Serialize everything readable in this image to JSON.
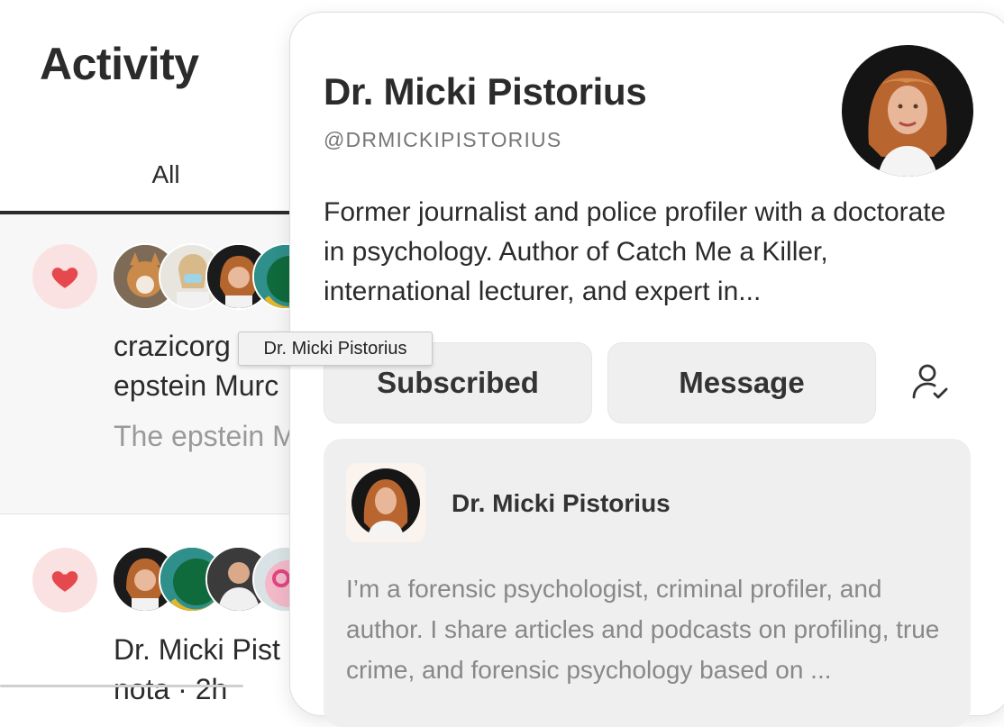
{
  "activity": {
    "title": "Activity",
    "tab_all": "All",
    "items": [
      {
        "line1": "crazicorg",
        "line2": "epstein Murc",
        "preview": "The epstein M"
      },
      {
        "line1": "Dr. Micki Pist",
        "line2": "nota · 2h"
      }
    ]
  },
  "tooltip": "Dr. Micki Pistorius",
  "profile": {
    "name": "Dr. Micki Pistorius",
    "handle": "@DRMICKIPISTORIUS",
    "bio": "Former journalist and police profiler with a doctorate in psychology. Author of Catch Me a Killer, international lecturer, and expert in...",
    "subscribe_label": "Subscribed",
    "message_label": "Message",
    "publication": {
      "name": "Dr. Micki Pistorius",
      "description": "I’m a forensic psychologist, criminal profiler, and author. I share articles and podcasts on profiling, true crime, and forensic psychology based on ..."
    }
  },
  "icons": {
    "heart": "heart-icon",
    "person_check": "person-check-icon"
  },
  "colors": {
    "heart": "#e5484d",
    "heart_bg": "#fbe2e2"
  }
}
